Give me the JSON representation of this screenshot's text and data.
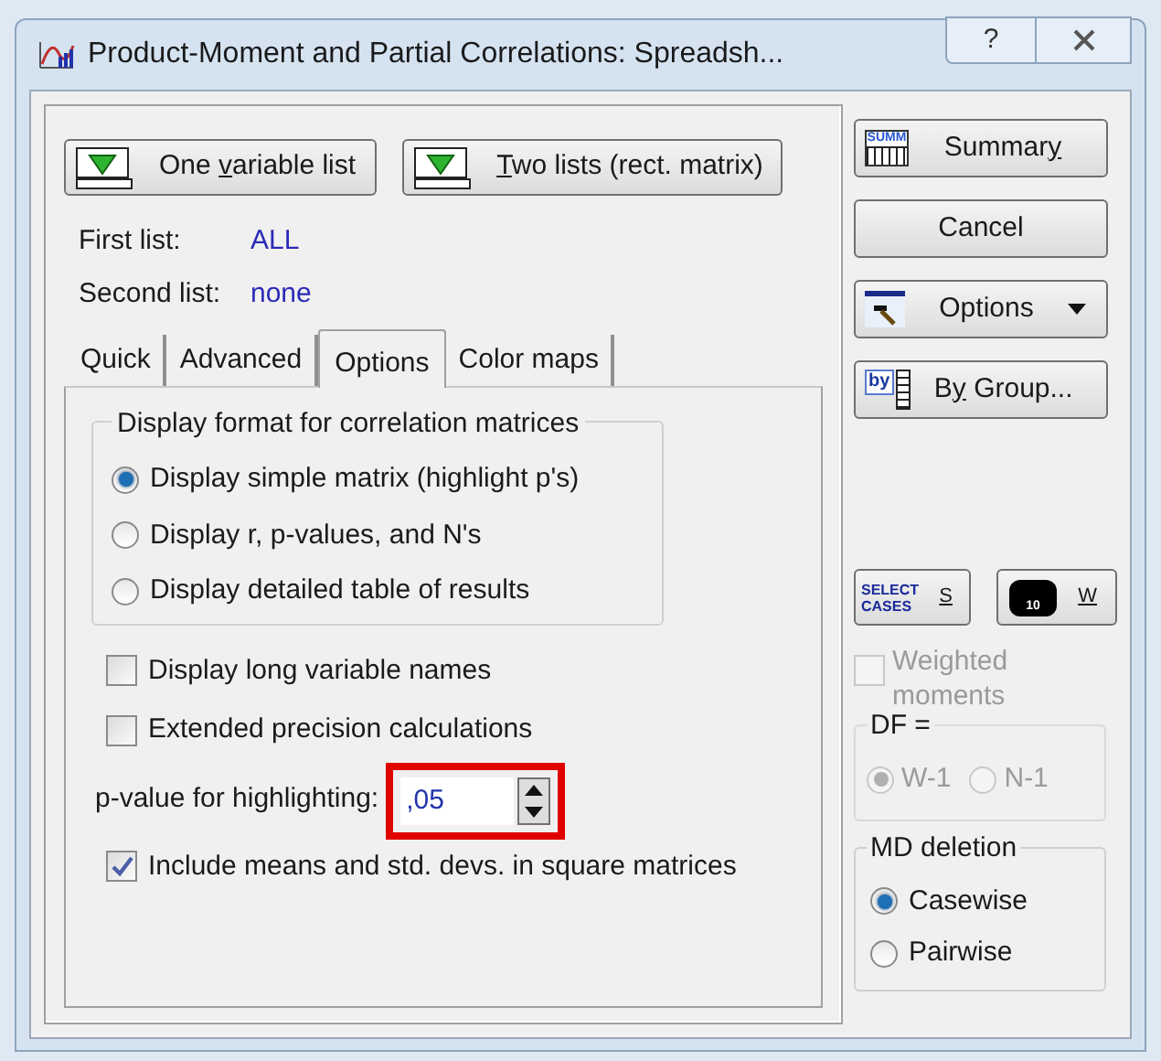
{
  "window": {
    "title": "Product-Moment and Partial Correlations: Spreadsh...",
    "help": "?"
  },
  "list_buttons": [
    {
      "before": "One ",
      "mnemonic": "v",
      "after": "ariable list"
    },
    {
      "mnemonic": "T",
      "after": "wo lists (rect. matrix)"
    }
  ],
  "lists": [
    {
      "label": "First list:",
      "value": "ALL"
    },
    {
      "label": "Second list:",
      "value": "none"
    }
  ],
  "tabs": [
    {
      "label": "Quick",
      "selected": false
    },
    {
      "label": "Advanced",
      "selected": false
    },
    {
      "label": "Options",
      "selected": true
    },
    {
      "label": "Color maps",
      "selected": false
    }
  ],
  "display_format": {
    "title": "Display format for correlation matrices",
    "options": [
      {
        "label": "Display simple matrix (highlight p's)",
        "selected": true
      },
      {
        "label": "Display r, p-values, and N's",
        "selected": false
      },
      {
        "label": "Display detailed table of results",
        "selected": false
      }
    ]
  },
  "checkboxes_top": [
    {
      "label": "Display long variable names",
      "checked": false
    },
    {
      "label": "Extended precision calculations",
      "checked": false
    }
  ],
  "p_value": {
    "label": "p-value for highlighting:",
    "value": ",05",
    "highlighted": true
  },
  "checkboxes_bottom": [
    {
      "label": "Include means and std. devs. in square matrices",
      "checked": true
    }
  ],
  "side_buttons": [
    {
      "kind": "summary",
      "before": "Summar",
      "mnemonic": "y",
      "icon_text": "SUMM"
    },
    {
      "kind": "plain",
      "before": "Cancel"
    },
    {
      "kind": "options",
      "before": "Options"
    },
    {
      "kind": "bygroup",
      "before": "B",
      "mnemonic": "y",
      "after": " Group...",
      "icon_text": "by"
    }
  ],
  "select_cases": {
    "icon_text": "SELECT CASES",
    "key": "S"
  },
  "weight": {
    "icon_text": "10",
    "key": "W"
  },
  "weighted_moments": {
    "label": "Weighted moments",
    "checked": false,
    "disabled": true
  },
  "df": {
    "title": "DF =",
    "disabled": true,
    "options": [
      {
        "label": "W-1",
        "selected": true
      },
      {
        "label": "N-1",
        "selected": false
      }
    ]
  },
  "md_deletion": {
    "title": "MD deletion",
    "options": [
      {
        "label": "Casewise",
        "selected": true
      },
      {
        "label": "Pairwise",
        "selected": false
      }
    ]
  }
}
